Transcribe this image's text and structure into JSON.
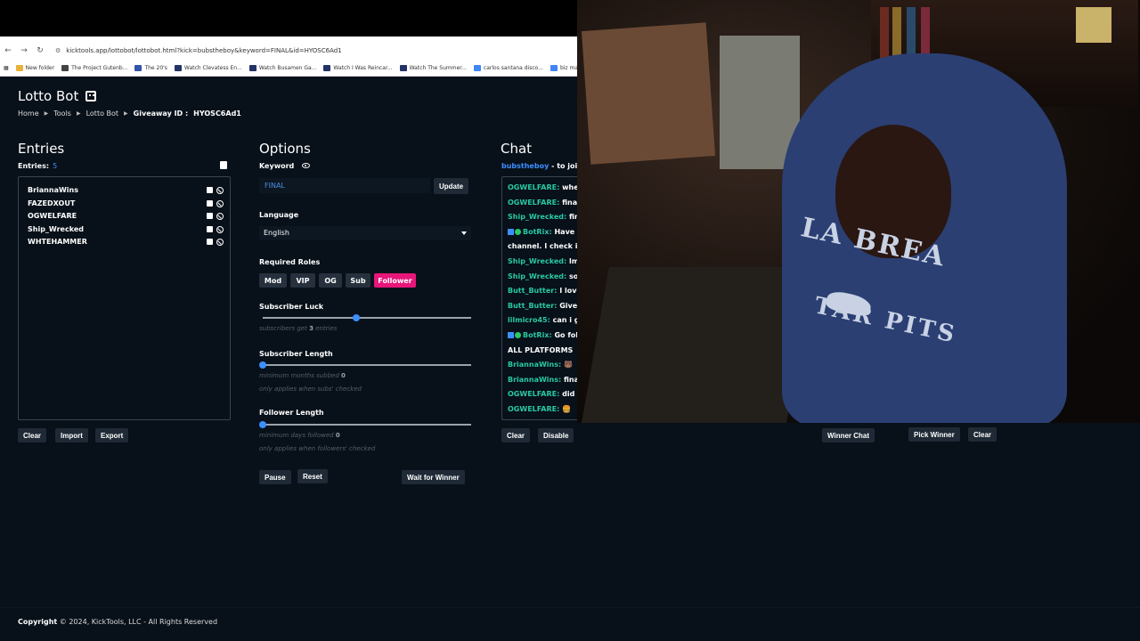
{
  "browser": {
    "nav": [
      "←",
      "→",
      "↻"
    ],
    "url": "kicktools.app/lottobot/lottobot.html?kick=bubstheboy&keyword=FINAL&id=HYOSC6Ad1",
    "bookmarks": [
      {
        "label": "New folder",
        "color": "#e8b23a"
      },
      {
        "label": "The Project Gutenb...",
        "color": "#444444"
      },
      {
        "label": "The 20's",
        "color": "#3355aa"
      },
      {
        "label": "Watch Clevatess En...",
        "color": "#223366"
      },
      {
        "label": "Watch Busamen Ga...",
        "color": "#223366"
      },
      {
        "label": "Watch I Was Reincar...",
        "color": "#223366"
      },
      {
        "label": "Watch The Summer...",
        "color": "#223366"
      },
      {
        "label": "carlos santana disco...",
        "color": "#4285f4"
      },
      {
        "label": "biz markie the biz is...",
        "color": "#4285f4"
      }
    ]
  },
  "header": {
    "title": "Lotto Bot",
    "breadcrumb": [
      "Home",
      "Tools",
      "Lotto Bot"
    ],
    "giveaway_label": "Giveaway ID :",
    "giveaway_id": "HYOSC6Ad1"
  },
  "entries": {
    "title": "Entries",
    "count_label": "Entries:",
    "count": "5",
    "items": [
      "BriannaWins",
      "FAZEDXOUT",
      "OGWELFARE",
      "Ship_Wrecked",
      "WHTEHAMMER"
    ],
    "buttons": [
      "Clear",
      "Import",
      "Export"
    ]
  },
  "options": {
    "title": "Options",
    "keyword_label": "Keyword",
    "keyword_value": "FINAL",
    "update_label": "Update",
    "language_label": "Language",
    "language_value": "English",
    "roles_label": "Required Roles",
    "roles": [
      "Mod",
      "VIP",
      "OG",
      "Sub",
      "Follower"
    ],
    "active_role": "Follower",
    "sub_luck_label": "Subscriber Luck",
    "sub_luck_hint": "subscribers get",
    "sub_luck_value": "3",
    "sub_luck_unit": "entries",
    "sub_luck_level": 0.45,
    "sub_length_label": "Subscriber Length",
    "sub_length_hint": "minimum months subbed",
    "sub_length_value": "0",
    "sub_length_note": "only applies when subs' checked",
    "sub_length_level": 0,
    "follower_length_label": "Follower Length",
    "follower_length_hint": "minimum days followed",
    "follower_length_value": "0",
    "follower_length_note": "only applies when followers' checked",
    "follower_length_level": 0,
    "pause_label": "Pause",
    "reset_label": "Reset",
    "wait_label": "Wait for Winner"
  },
  "chat": {
    "title": "Chat",
    "header_user": "bubstheboy",
    "header_text": " - to join,",
    "messages": [
      {
        "user": "OGWELFARE:",
        "text": " whe"
      },
      {
        "user": "OGWELFARE:",
        "text": " fina"
      },
      {
        "user": "Ship_Wrecked:",
        "text": " finc"
      },
      {
        "user": "BotRix:",
        "text": " Have a",
        "bot": true
      },
      {
        "user": "",
        "text": "channel. I check it c"
      },
      {
        "user": "Ship_Wrecked:",
        "text": " lmc"
      },
      {
        "user": "Ship_Wrecked:",
        "text": " sorr"
      },
      {
        "user": "Butt_Butter:",
        "text": " I love"
      },
      {
        "user": "Butt_Butter:",
        "text": " Give n"
      },
      {
        "user": "lilmicro45:",
        "text": " can i ge"
      },
      {
        "user": "BotRix:",
        "text": " Go follo",
        "bot": true
      },
      {
        "user": "",
        "text": "ALL PLATFORMS"
      },
      {
        "user": "BriannaWins:",
        "text": " 🐻"
      },
      {
        "user": "BriannaWins:",
        "text": " final"
      },
      {
        "user": "OGWELFARE:",
        "text": " did"
      },
      {
        "user": "OGWELFARE:",
        "text": " 🍔"
      }
    ],
    "clear_label": "Clear",
    "disable_label": "Disable"
  },
  "winner": {
    "winner_chat_label": "Winner Chat",
    "pick_label": "Pick Winner",
    "clear_label": "Clear"
  },
  "shirt": {
    "line1": "LA BREA",
    "line2": "TAR PITS"
  },
  "footer": {
    "copyright_label": "Copyright",
    "copyright_text": "© 2024, KickTools, LLC - All Rights Reserved"
  },
  "colors": {
    "accent": "#e8157a",
    "link": "#3b8fff",
    "chat_user": "#27c9a4",
    "bg": "#081019"
  }
}
